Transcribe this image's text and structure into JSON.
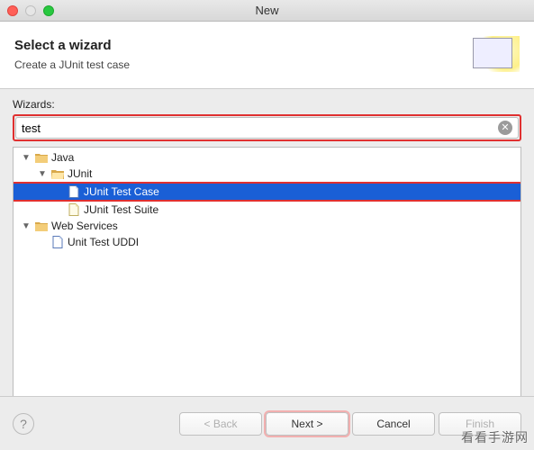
{
  "window": {
    "title": "New"
  },
  "header": {
    "heading": "Select a wizard",
    "subheading": "Create a JUnit test case"
  },
  "wizards": {
    "label": "Wizards:",
    "search_value": "test",
    "clear_icon": "clear",
    "tree": {
      "java": {
        "label": "Java",
        "icon": "folder"
      },
      "junit": {
        "label": "JUnit",
        "icon": "folder-open"
      },
      "junit_test_case": {
        "label": "JUnit Test Case",
        "icon": "file"
      },
      "junit_test_suite": {
        "label": "JUnit Test Suite",
        "icon": "file"
      },
      "web_services": {
        "label": "Web Services",
        "icon": "folder"
      },
      "unit_test_uddi": {
        "label": "Unit Test UDDI",
        "icon": "file"
      }
    }
  },
  "footer": {
    "help": "?",
    "back": "< Back",
    "next": "Next >",
    "cancel": "Cancel",
    "finish": "Finish"
  },
  "watermark": "看看手游网"
}
